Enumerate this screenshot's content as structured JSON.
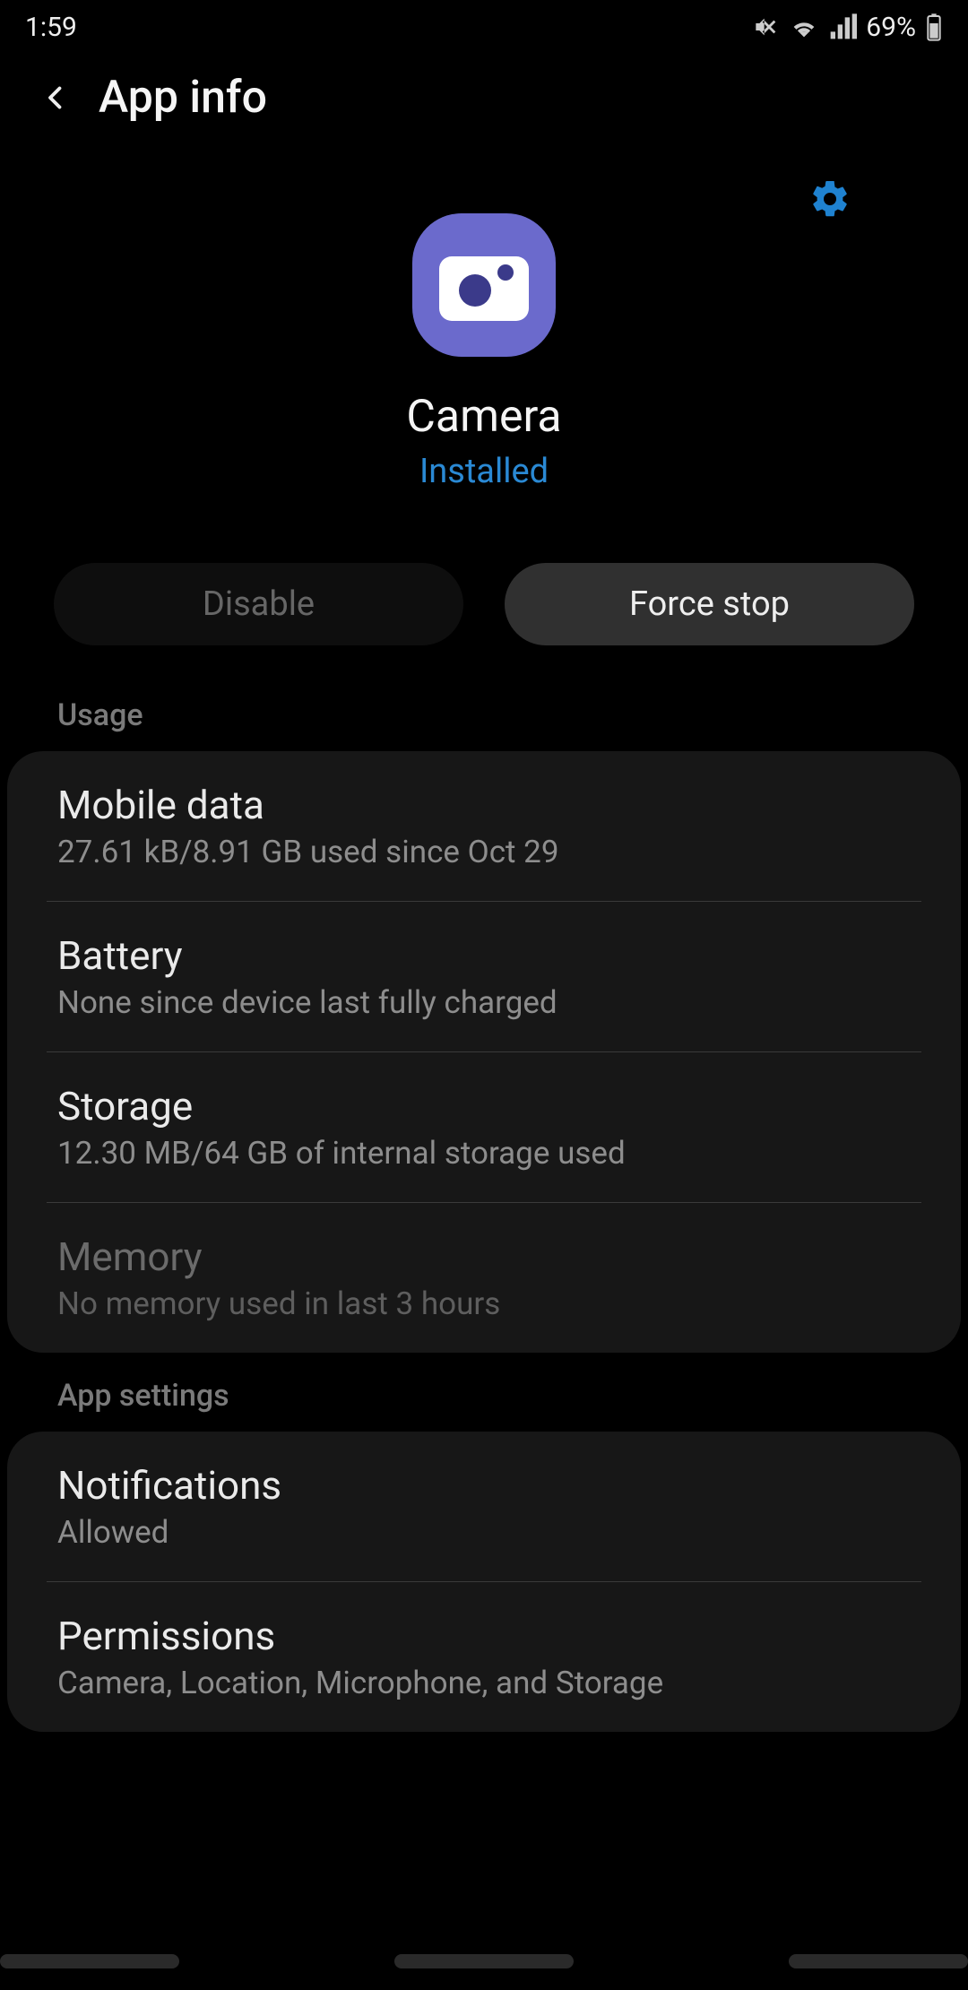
{
  "status_bar": {
    "time": "1:59",
    "battery_text": "69%"
  },
  "header": {
    "title": "App info"
  },
  "app": {
    "name": "Camera",
    "status": "Installed"
  },
  "actions": {
    "disable": "Disable",
    "force_stop": "Force stop"
  },
  "sections": {
    "usage": {
      "label": "Usage",
      "items": [
        {
          "title": "Mobile data",
          "sub": "27.61 kB/8.91 GB used since Oct 29",
          "dim": false
        },
        {
          "title": "Battery",
          "sub": "None since device last fully charged",
          "dim": false
        },
        {
          "title": "Storage",
          "sub": "12.30 MB/64 GB of internal storage used",
          "dim": false
        },
        {
          "title": "Memory",
          "sub": "No memory used in last 3 hours",
          "dim": true
        }
      ]
    },
    "app_settings": {
      "label": "App settings",
      "items": [
        {
          "title": "Notifications",
          "sub": "Allowed",
          "dim": false
        },
        {
          "title": "Permissions",
          "sub": "Camera, Location, Microphone, and Storage",
          "dim": false
        }
      ]
    }
  }
}
